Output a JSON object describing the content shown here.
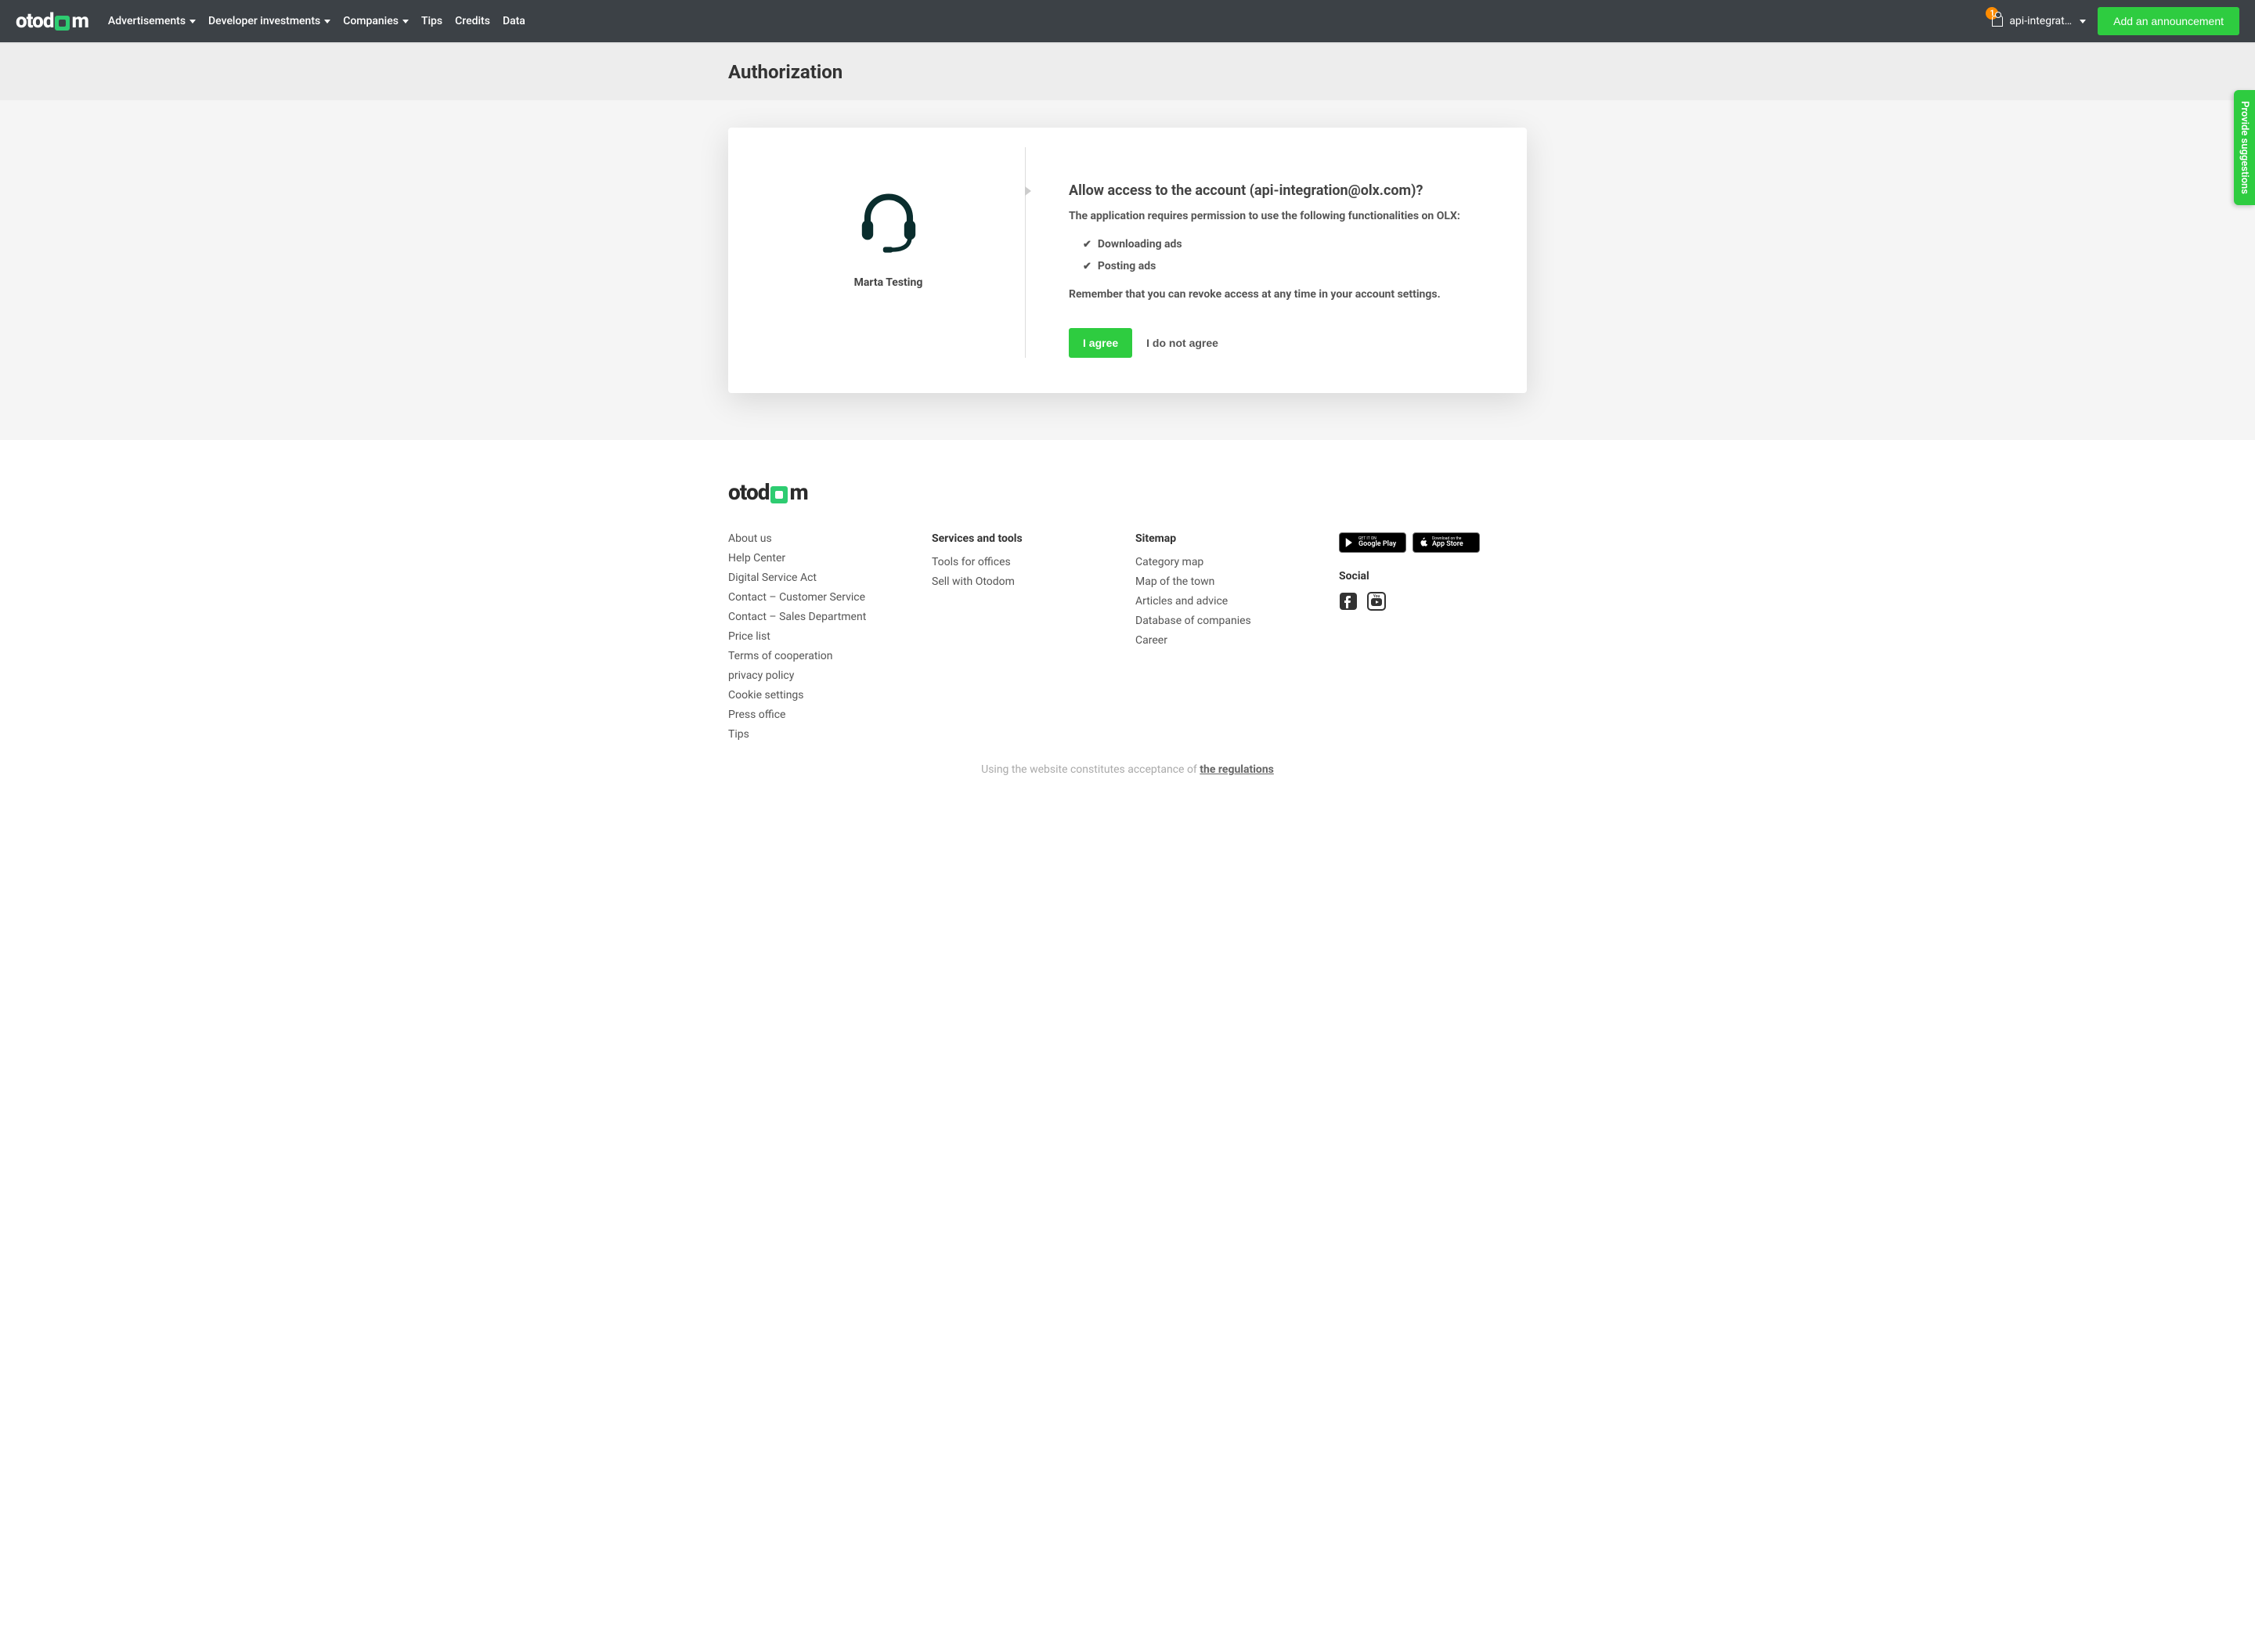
{
  "brand": "otodom",
  "nav": {
    "items": [
      {
        "label": "Advertisements",
        "dropdown": true
      },
      {
        "label": "Developer investments",
        "dropdown": true
      },
      {
        "label": "Companies",
        "dropdown": true
      },
      {
        "label": "Tips",
        "dropdown": false
      },
      {
        "label": "Credits",
        "dropdown": false
      },
      {
        "label": "Data",
        "dropdown": false
      }
    ]
  },
  "user": {
    "display": "api-integrat…",
    "badge": "1"
  },
  "cta_button": "Add an announcement",
  "page_title": "Authorization",
  "auth": {
    "app_name": "Marta Testing",
    "title": "Allow access to the account (api-integration@olx.com)?",
    "subtitle": "The application requires permission to use the following functionalities on OLX:",
    "permissions": [
      "Downloading ads",
      "Posting ads"
    ],
    "note": "Remember that you can revoke access at any time in your account settings.",
    "agree": "I agree",
    "disagree": "I do not agree"
  },
  "feedback_tab": "Provide suggestions",
  "footer": {
    "col1": [
      "About us",
      "Help Center",
      "Digital Service Act",
      "Contact – Customer Service",
      "Contact – Sales Department",
      "Price list",
      "Terms of cooperation",
      "privacy policy",
      "Cookie settings",
      "Press office",
      "Tips"
    ],
    "col2_title": "Services and tools",
    "col2": [
      "Tools for offices",
      "Sell with Otodom"
    ],
    "col3_title": "Sitemap",
    "col3": [
      "Category map",
      "Map of the town",
      "Articles and advice",
      "Database of companies",
      "Career"
    ],
    "store_google_sm": "GET IT ON",
    "store_google_lg": "Google Play",
    "store_apple_sm": "Download on the",
    "store_apple_lg": "App Store",
    "social_title": "Social",
    "bottom_text": "Using the website constitutes acceptance of ",
    "bottom_link": "the regulations"
  }
}
